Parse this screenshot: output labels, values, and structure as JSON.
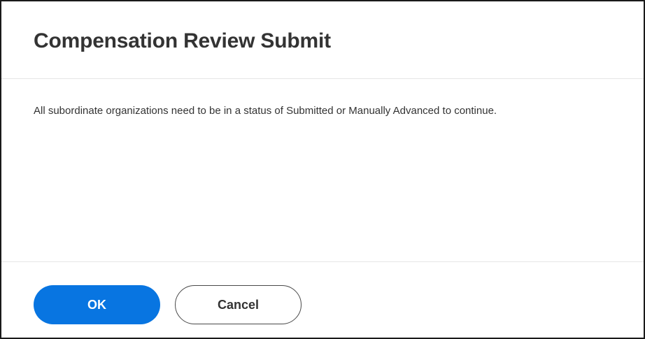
{
  "dialog": {
    "title": "Compensation Review Submit",
    "message": "All subordinate organizations need to be in a status of Submitted or Manually Advanced to continue.",
    "buttons": {
      "ok_label": "OK",
      "cancel_label": "Cancel"
    },
    "colors": {
      "primary": "#0875e1",
      "text": "#333333",
      "border": "#1a1a1a",
      "divider": "#e6e6e6"
    }
  }
}
